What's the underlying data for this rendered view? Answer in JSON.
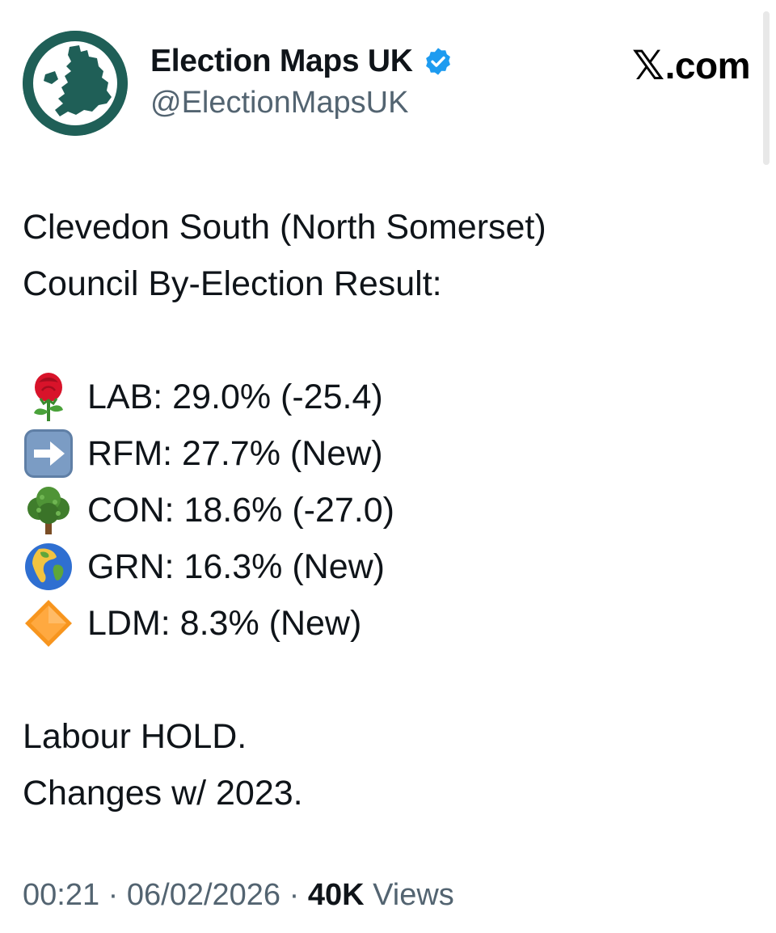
{
  "author": {
    "display_name": "Election Maps UK",
    "handle": "@ElectionMapsUK",
    "verified": true,
    "avatar_icon": "uk-map-logo-icon"
  },
  "brand": {
    "mark": "𝕏",
    "suffix": ".com"
  },
  "tweet": {
    "title_lines": [
      "Clevedon South (North Somerset)",
      "Council By-Election Result:"
    ],
    "results": [
      {
        "icon": "rose-icon",
        "text": "LAB: 29.0% (-25.4)"
      },
      {
        "icon": "right-arrow-icon",
        "text": "RFM: 27.7% (New)"
      },
      {
        "icon": "tree-icon",
        "text": "CON: 18.6% (-27.0)"
      },
      {
        "icon": "globe-icon",
        "text": "GRN: 16.3% (New)"
      },
      {
        "icon": "orange-diamond-icon",
        "text": "LDM: 8.3% (New)"
      }
    ],
    "outcome_lines": [
      "Labour HOLD.",
      "Changes w/ 2023."
    ]
  },
  "meta": {
    "time": "00:21",
    "separator": "·",
    "date": "06/02/2026",
    "views_count": "40K",
    "views_label": "Views"
  },
  "colors": {
    "avatar_bg": "#1f5f57",
    "verified_blue": "#1d9bf0",
    "text_primary": "#0f1419",
    "text_secondary": "#536471"
  }
}
